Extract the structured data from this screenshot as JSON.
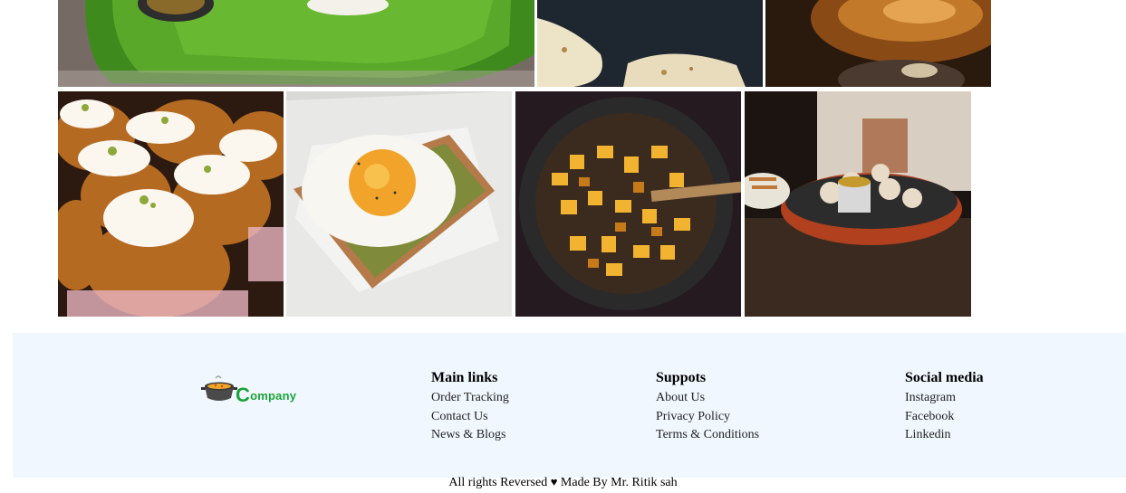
{
  "gallery": {
    "row1": [
      {
        "name": "banana-leaf-meal-photo"
      },
      {
        "name": "naan-bread-photo"
      },
      {
        "name": "copper-pot-photo"
      }
    ],
    "row2": [
      {
        "name": "cupcakes-photo"
      },
      {
        "name": "fried-egg-toast-photo"
      },
      {
        "name": "spiced-potatoes-pan-photo"
      },
      {
        "name": "momos-platter-photo"
      }
    ]
  },
  "footer": {
    "logo": {
      "initial": "C",
      "rest": "ompany"
    },
    "columns": [
      {
        "title": "Main links",
        "items": [
          "Order Tracking",
          "Contact Us",
          "News & Blogs"
        ]
      },
      {
        "title": "Suppots",
        "items": [
          "About Us",
          "Privacy Policy",
          "Terms & Conditions"
        ]
      },
      {
        "title": "Social media",
        "items": [
          "Instagram",
          "Facebook",
          "Linkedin"
        ]
      }
    ],
    "copyright": {
      "before": "All rights Reversed",
      "heart": "♥",
      "after": "Made By Mr. Ritik sah"
    }
  },
  "colors": {
    "footer_bg": "#f0f7fe",
    "brand_green": "#1aa33a"
  }
}
